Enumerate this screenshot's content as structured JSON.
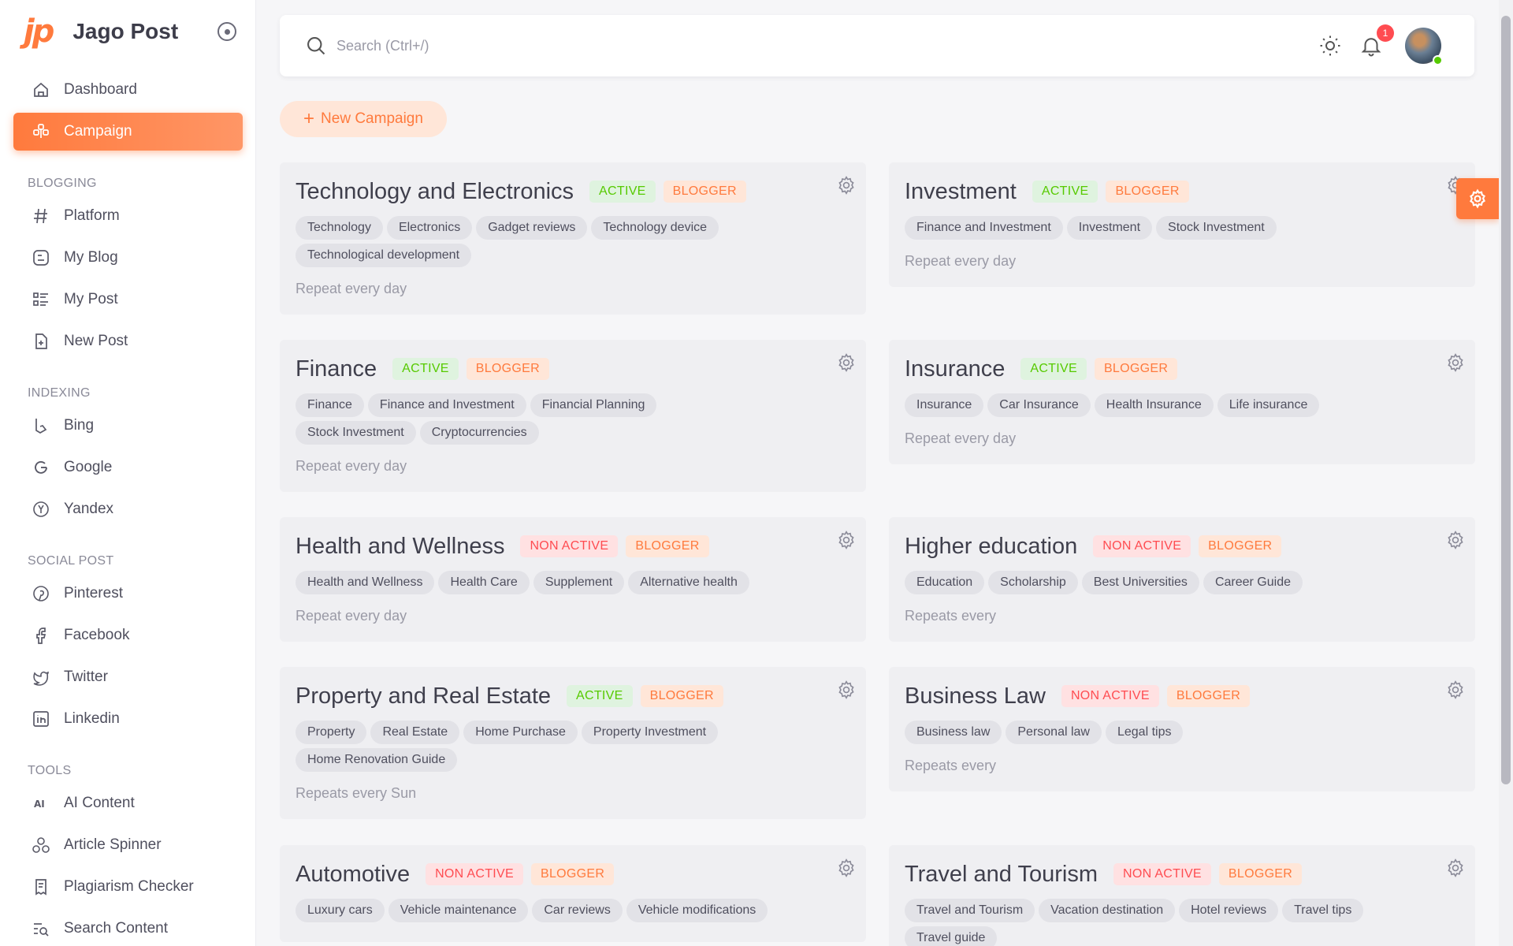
{
  "brand": {
    "logo": "jp",
    "name": "Jago Post"
  },
  "nav": {
    "top_items": [
      {
        "label": "Dashboard",
        "icon": "home-icon"
      },
      {
        "label": "Campaign",
        "icon": "campaign-icon",
        "active": true
      }
    ],
    "sections": [
      {
        "title": "BLOGGING",
        "items": [
          {
            "label": "Platform",
            "icon": "hash-icon"
          },
          {
            "label": "My Blog",
            "icon": "blog-icon"
          },
          {
            "label": "My Post",
            "icon": "list-icon"
          },
          {
            "label": "New Post",
            "icon": "file-plus-icon"
          }
        ]
      },
      {
        "title": "INDEXING",
        "items": [
          {
            "label": "Bing",
            "icon": "bing-icon"
          },
          {
            "label": "Google",
            "icon": "google-icon"
          },
          {
            "label": "Yandex",
            "icon": "yandex-icon"
          }
        ]
      },
      {
        "title": "SOCIAL POST",
        "items": [
          {
            "label": "Pinterest",
            "icon": "pinterest-icon"
          },
          {
            "label": "Facebook",
            "icon": "facebook-icon"
          },
          {
            "label": "Twitter",
            "icon": "twitter-icon"
          },
          {
            "label": "Linkedin",
            "icon": "linkedin-icon"
          }
        ]
      },
      {
        "title": "TOOLS",
        "items": [
          {
            "label": "AI Content",
            "icon": "ai-icon"
          },
          {
            "label": "Article Spinner",
            "icon": "spinner-icon"
          },
          {
            "label": "Plagiarism Checker",
            "icon": "checker-icon"
          },
          {
            "label": "Search Content",
            "icon": "search-content-icon"
          }
        ]
      }
    ]
  },
  "header": {
    "search_placeholder": "Search (Ctrl+/)",
    "notification_count": "1"
  },
  "actions": {
    "new_campaign": "New Campaign"
  },
  "campaigns": [
    {
      "title": "Technology and Electronics",
      "status": "ACTIVE",
      "status_type": "active",
      "platform": "BLOGGER",
      "tags": [
        "Technology",
        "Electronics",
        "Gadget reviews",
        "Technology device",
        "Technological development"
      ],
      "repeat": "Repeat every day"
    },
    {
      "title": "Investment",
      "status": "ACTIVE",
      "status_type": "active",
      "platform": "BLOGGER",
      "tags": [
        "Finance and Investment",
        "Investment",
        "Stock Investment"
      ],
      "repeat": "Repeat every day"
    },
    {
      "title": "Finance",
      "status": "ACTIVE",
      "status_type": "active",
      "platform": "BLOGGER",
      "tags": [
        "Finance",
        "Finance and Investment",
        "Financial Planning",
        "Stock Investment",
        "Cryptocurrencies"
      ],
      "repeat": "Repeat every day"
    },
    {
      "title": "Insurance",
      "status": "ACTIVE",
      "status_type": "active",
      "platform": "BLOGGER",
      "tags": [
        "Insurance",
        "Car Insurance",
        "Health Insurance",
        "Life insurance"
      ],
      "repeat": "Repeat every day"
    },
    {
      "title": "Health and Wellness",
      "status": "NON ACTIVE",
      "status_type": "nonactive",
      "platform": "BLOGGER",
      "tags": [
        "Health and Wellness",
        "Health Care",
        "Supplement",
        "Alternative health"
      ],
      "repeat": "Repeat every day"
    },
    {
      "title": "Higher education",
      "status": "NON ACTIVE",
      "status_type": "nonactive",
      "platform": "BLOGGER",
      "tags": [
        "Education",
        "Scholarship",
        "Best Universities",
        "Career Guide"
      ],
      "repeat": "Repeats every"
    },
    {
      "title": "Property and Real Estate",
      "status": "ACTIVE",
      "status_type": "active",
      "platform": "BLOGGER",
      "tags": [
        "Property",
        "Real Estate",
        "Home Purchase",
        "Property Investment",
        "Home Renovation Guide"
      ],
      "repeat": "Repeats every Sun"
    },
    {
      "title": "Business Law",
      "status": "NON ACTIVE",
      "status_type": "nonactive",
      "platform": "BLOGGER",
      "tags": [
        "Business law",
        "Personal law",
        "Legal tips"
      ],
      "repeat": "Repeats every"
    },
    {
      "title": "Automotive",
      "status": "NON ACTIVE",
      "status_type": "nonactive",
      "platform": "BLOGGER",
      "tags": [
        "Luxury cars",
        "Vehicle maintenance",
        "Car reviews",
        "Vehicle modifications"
      ],
      "repeat": ""
    },
    {
      "title": "Travel and Tourism",
      "status": "NON ACTIVE",
      "status_type": "nonactive",
      "platform": "BLOGGER",
      "tags": [
        "Travel and Tourism",
        "Vacation destination",
        "Hotel reviews",
        "Travel tips",
        "Travel guide"
      ],
      "repeat": ""
    }
  ],
  "colors": {
    "accent": "#ff7a3d",
    "active": "#56ca00",
    "nonactive": "#ff4c51"
  }
}
